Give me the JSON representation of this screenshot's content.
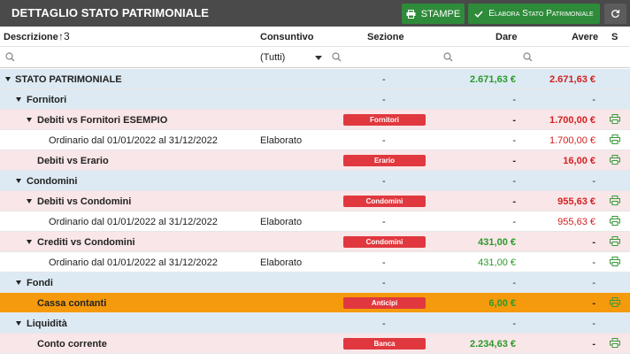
{
  "title": "DETTAGLIO STATO PATRIMONIALE",
  "toolbar": {
    "stampe_label": "STAMPE",
    "elabora_label": "Elabora Stato Patrimoniale",
    "colors": {
      "primary": "#2e8b3a",
      "header": "#4a4a4a"
    }
  },
  "columns": {
    "descrizione": "Descrizione",
    "sort_indicator": "↑3",
    "consuntivo": "Consuntivo",
    "sezione": "Sezione",
    "dare": "Dare",
    "avere": "Avere",
    "s": "S"
  },
  "filters": {
    "consuntivo_selected": "(Tutti)"
  },
  "rows": [
    {
      "desc": "STATO PATRIMONIALE",
      "consuntivo": "",
      "sezione": "-",
      "dare": "2.671,63 €",
      "avere": "2.671,63 €"
    },
    {
      "desc": "Fornitori",
      "consuntivo": "",
      "sezione": "-",
      "dare": "-",
      "avere": "-"
    },
    {
      "desc": "Debiti vs Fornitori ESEMPIO",
      "consuntivo": "",
      "sezione": "Fornitori",
      "dare": "-",
      "avere": "1.700,00 €"
    },
    {
      "desc": "Ordinario dal 01/01/2022 al 31/12/2022",
      "consuntivo": "Elaborato",
      "sezione": "-",
      "dare": "-",
      "avere": "1.700,00 €"
    },
    {
      "desc": "Debiti vs Erario",
      "consuntivo": "",
      "sezione": "Erario",
      "dare": "-",
      "avere": "16,00 €"
    },
    {
      "desc": "Condomini",
      "consuntivo": "",
      "sezione": "-",
      "dare": "-",
      "avere": "-"
    },
    {
      "desc": "Debiti vs Condomini",
      "consuntivo": "",
      "sezione": "Condomini",
      "dare": "-",
      "avere": "955,63 €"
    },
    {
      "desc": "Ordinario dal 01/01/2022 al 31/12/2022",
      "consuntivo": "Elaborato",
      "sezione": "-",
      "dare": "-",
      "avere": "955,63 €"
    },
    {
      "desc": "Crediti vs Condomini",
      "consuntivo": "",
      "sezione": "Condomini",
      "dare": "431,00 €",
      "avere": "-"
    },
    {
      "desc": "Ordinario dal 01/01/2022 al 31/12/2022",
      "consuntivo": "Elaborato",
      "sezione": "-",
      "dare": "431,00 €",
      "avere": "-"
    },
    {
      "desc": "Fondi",
      "consuntivo": "",
      "sezione": "-",
      "dare": "-",
      "avere": "-"
    },
    {
      "desc": "Cassa contanti",
      "consuntivo": "",
      "sezione": "Anticipi",
      "dare": "6,00 €",
      "avere": "-"
    },
    {
      "desc": "Liquidità",
      "consuntivo": "",
      "sezione": "-",
      "dare": "-",
      "avere": "-"
    },
    {
      "desc": "Conto corrente",
      "consuntivo": "",
      "sezione": "Banca",
      "dare": "2.234,63 €",
      "avere": "-"
    }
  ]
}
